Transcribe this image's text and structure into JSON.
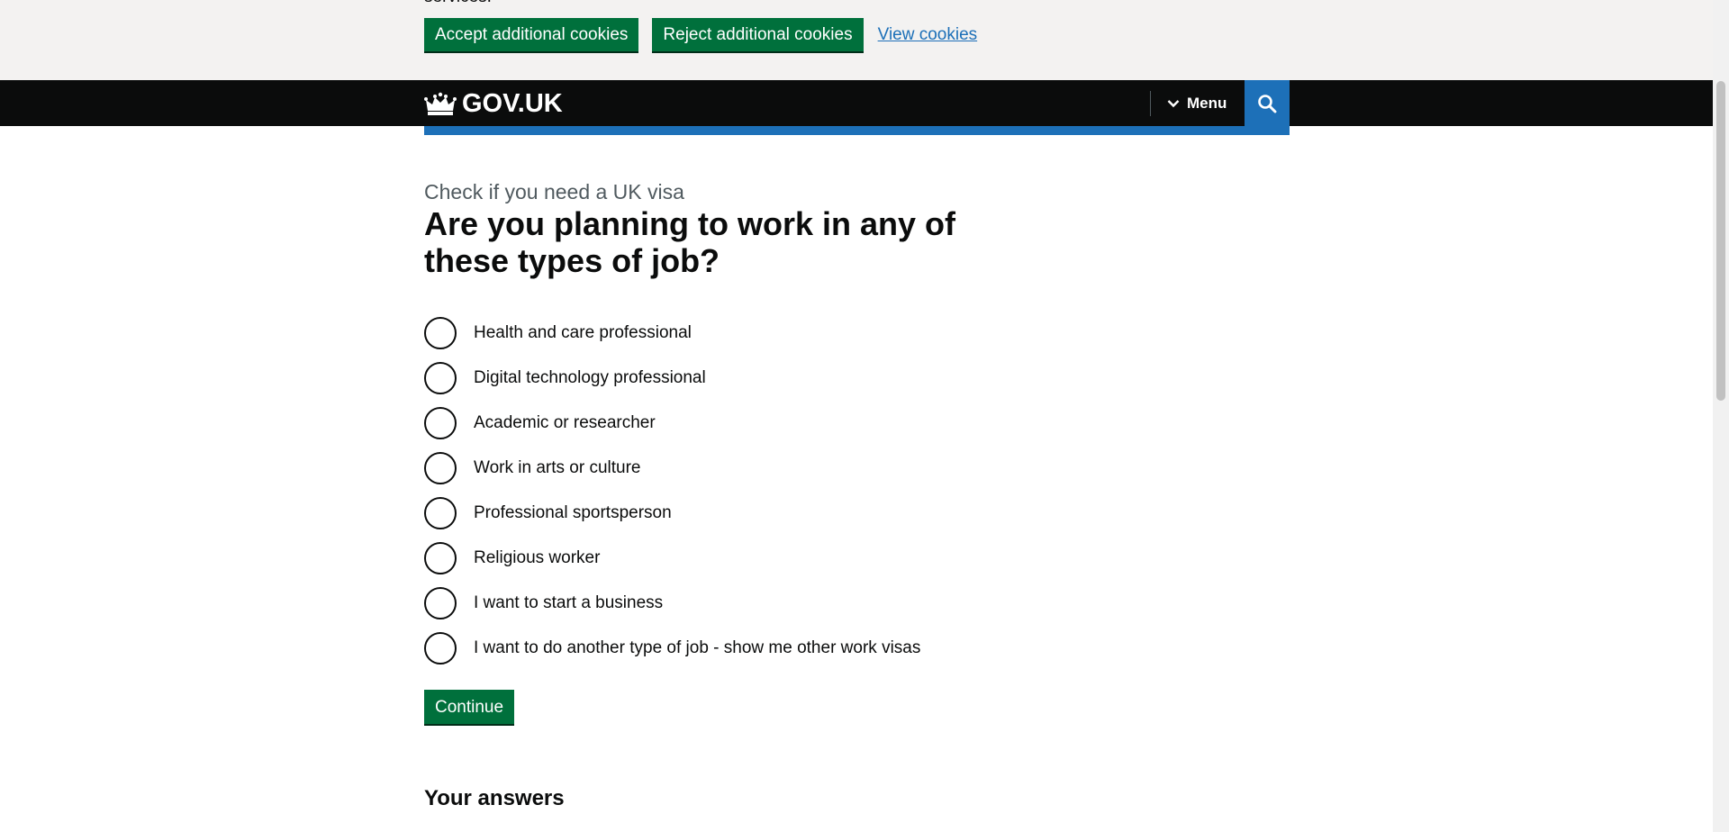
{
  "cookie_banner": {
    "cut_text": "services.",
    "accept_label": "Accept additional cookies",
    "reject_label": "Reject additional cookies",
    "view_label": "View cookies"
  },
  "header": {
    "logo_text": "GOV.UK",
    "menu_label": "Menu",
    "search_icon": "search-icon"
  },
  "main": {
    "caption": "Check if you need a UK visa",
    "heading": "Are you planning to work in any of these types of job?",
    "options": [
      "Health and care professional",
      "Digital technology professional",
      "Academic or researcher",
      "Work in arts or culture",
      "Professional sportsperson",
      "Religious worker",
      "I want to start a business",
      "I want to do another type of job - show me other work visas"
    ],
    "continue_label": "Continue",
    "answers_heading": "Your answers"
  },
  "colors": {
    "brand_black": "#0b0c0c",
    "gov_blue": "#1d70b8",
    "button_green": "#00703c",
    "banner_grey": "#f3f2f1"
  }
}
